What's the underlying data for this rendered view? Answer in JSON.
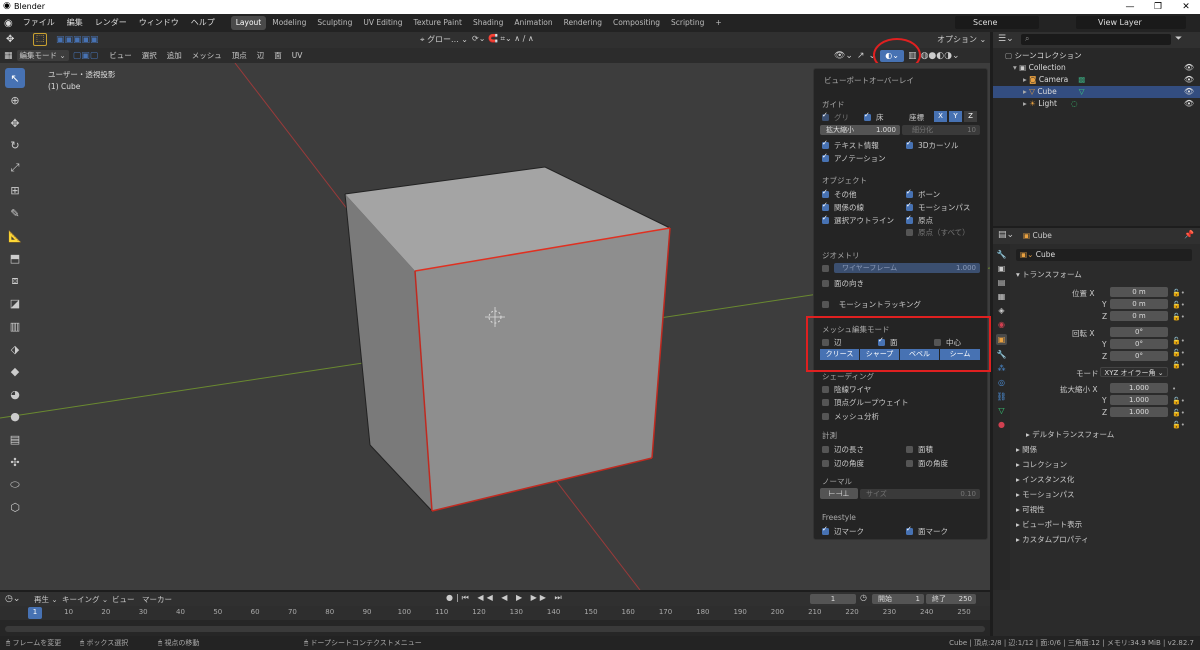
{
  "app": {
    "title": "Blender"
  },
  "window_controls": {
    "minimize": "—",
    "maximize": "❐",
    "close": "✕"
  },
  "menu": {
    "items": [
      "ファイル",
      "編集",
      "レンダー",
      "ウィンドウ",
      "ヘルプ"
    ],
    "workspaces": [
      "Layout",
      "Modeling",
      "Sculpting",
      "UV Editing",
      "Texture Paint",
      "Shading",
      "Animation",
      "Rendering",
      "Compositing",
      "Scripting"
    ],
    "active_workspace": "Layout",
    "scene": "Scene",
    "view_layer": "View Layer"
  },
  "viewport_header": {
    "mode": "編集モード",
    "menu_items": [
      "ビュー",
      "選択",
      "追加",
      "メッシュ",
      "頂点",
      "辺",
      "面",
      "UV"
    ],
    "transform": "グロー...",
    "options": "オプション",
    "view_label": "ユーザー・透視投影",
    "object_label": "(1) Cube"
  },
  "toolbar": {
    "icons": [
      "select-box-icon",
      "cursor-icon",
      "move-icon",
      "rotate-icon",
      "scale-icon",
      "transform-icon",
      "annotate-icon",
      "measure-icon",
      "extrude-icon",
      "inset-icon",
      "bevel-icon",
      "loopcut-icon",
      "knife-icon",
      "polybuild-icon",
      "spin-icon",
      "smooth-icon",
      "edge-slide-icon",
      "shrink-icon",
      "shear-icon",
      "rip-icon"
    ]
  },
  "overlay": {
    "title": "ビューポートオーバーレイ",
    "guides": {
      "title": "ガイド",
      "grid": "グリ",
      "floor": "床",
      "axes": "座標",
      "axis_x": "X",
      "axis_y": "Y",
      "axis_z": "Z",
      "scale_label": "拡大縮小",
      "scale_value": "1.000",
      "subdiv_label": "細分化",
      "subdiv_value": "10",
      "text_info": "テキスト情報",
      "cursor3d": "3Dカーソル",
      "annotation": "アノテーション"
    },
    "objects": {
      "title": "オブジェクト",
      "extras": "その他",
      "bones": "ボーン",
      "relations": "関係の線",
      "motion_paths": "モーションパス",
      "outline": "選択アウトライン",
      "origins": "原点",
      "origins_all": "原点（すべて）"
    },
    "geometry": {
      "title": "ジオメトリ",
      "wireframe": "ワイヤーフレーム",
      "wireframe_value": "1.000",
      "face_orientation": "面の向き"
    },
    "motion_tracking": "モーショントラッキング",
    "mesh_edit": {
      "title": "メッシュ編集モード",
      "edges": "辺",
      "faces": "面",
      "center": "中心",
      "buttons": [
        "クリース",
        "シャープ",
        "ベベル",
        "シーム"
      ]
    },
    "shading": {
      "title": "シェーディング",
      "hidden_wire": "陰線ワイヤ",
      "vertex_group": "頂点グループウェイト",
      "mesh_analysis": "メッシュ分析"
    },
    "measurement": {
      "title": "計測",
      "edge_length": "辺の長さ",
      "face_area": "面積",
      "edge_angle": "辺の角度",
      "face_angle": "面の角度"
    },
    "normals": {
      "title": "ノーマル",
      "size_label": "サイズ",
      "size_value": "0.10"
    },
    "freestyle": {
      "title": "Freestyle",
      "edge_marks": "辺マーク",
      "face_marks": "面マーク"
    }
  },
  "outliner": {
    "root": "シーンコレクション",
    "collection": "Collection",
    "items": [
      {
        "name": "Camera"
      },
      {
        "name": "Cube"
      },
      {
        "name": "Light"
      }
    ]
  },
  "properties": {
    "object_path": "Cube",
    "object_name": "Cube",
    "transform_title": "トランスフォーム",
    "location_label": "位置 X",
    "loc": [
      "0 m",
      "0 m",
      "0 m"
    ],
    "rotation_label": "回転 X",
    "rot": [
      "0°",
      "0°",
      "0°"
    ],
    "mode_label": "モード",
    "mode_value": "XYZ オイラー角",
    "scale_label": "拡大縮小 X",
    "scale": [
      "1.000",
      "1.000",
      "1.000"
    ],
    "axis_y": "Y",
    "axis_z": "Z",
    "sections": [
      "デルタトランスフォーム",
      "関係",
      "コレクション",
      "インスタンス化",
      "モーションパス",
      "可視性",
      "ビューポート表示",
      "カスタムプロパティ"
    ]
  },
  "timeline": {
    "menu": [
      "再生",
      "キーイング",
      "ビュー",
      "マーカー"
    ],
    "current_frame": "1",
    "start_label": "開始",
    "start": "1",
    "end_label": "終了",
    "end": "250",
    "ticks": [
      "1",
      "10",
      "20",
      "30",
      "40",
      "50",
      "60",
      "70",
      "80",
      "90",
      "100",
      "110",
      "120",
      "130",
      "140",
      "150",
      "160",
      "170",
      "180",
      "190",
      "200",
      "210",
      "220",
      "230",
      "240",
      "250"
    ]
  },
  "status": {
    "left": [
      "フレームを変更",
      "ボックス選択",
      "視点の移動",
      "ドープシートコンテクストメニュー"
    ],
    "right": "Cube | 頂点:2/8 | 辺:1/12 | 面:0/6 | 三角面:12 | メモリ:34.9 MiB | v2.82.7"
  },
  "colors": {
    "accent": "#4772b3",
    "selection": "#334d80",
    "highlight_red": "#e02020"
  }
}
